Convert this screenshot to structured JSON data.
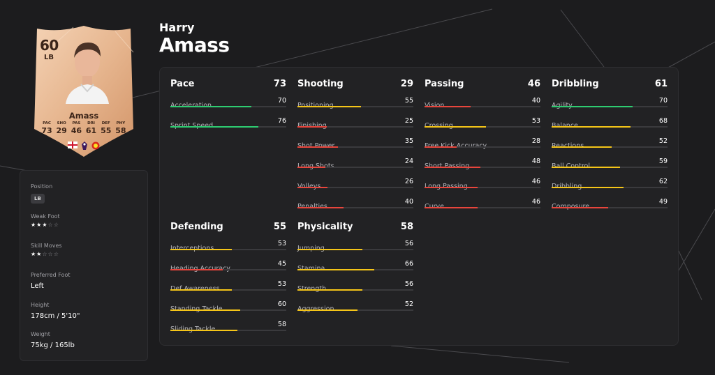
{
  "player": {
    "first_name": "Harry",
    "last_name": "Amass"
  },
  "card": {
    "rating": "60",
    "position": "LB",
    "name": "Amass",
    "stats": [
      {
        "label": "PAC",
        "value": "73"
      },
      {
        "label": "SHO",
        "value": "29"
      },
      {
        "label": "PAS",
        "value": "46"
      },
      {
        "label": "DRI",
        "value": "61"
      },
      {
        "label": "DEF",
        "value": "55"
      },
      {
        "label": "PHY",
        "value": "58"
      }
    ],
    "badges": [
      "england-flag-icon",
      "premier-league-icon",
      "manchester-united-crest-icon"
    ]
  },
  "info": {
    "position_label": "Position",
    "position_value": "LB",
    "weak_foot_label": "Weak Foot",
    "weak_foot_stars": 3,
    "skill_moves_label": "Skill Moves",
    "skill_moves_stars": 2,
    "preferred_foot_label": "Preferred Foot",
    "preferred_foot_value": "Left",
    "height_label": "Height",
    "height_value": "178cm / 5'10\"",
    "weight_label": "Weight",
    "weight_value": "75kg / 165lb"
  },
  "colors": {
    "bar_green": "#2ecc71",
    "bar_yellow": "#f5c518",
    "bar_red": "#e8453c",
    "card_light": "#f0c9a8",
    "card_dark": "#d99c72"
  },
  "groups": [
    {
      "key": "pace",
      "title": "Pace",
      "value": "73",
      "stats": [
        {
          "name": "Acceleration",
          "value": "70"
        },
        {
          "name": "Sprint Speed",
          "value": "76"
        }
      ]
    },
    {
      "key": "shooting",
      "title": "Shooting",
      "value": "29",
      "stats": [
        {
          "name": "Positioning",
          "value": "55"
        },
        {
          "name": "Finishing",
          "value": "25"
        },
        {
          "name": "Shot Power",
          "value": "35"
        },
        {
          "name": "Long Shots",
          "value": "24"
        },
        {
          "name": "Volleys",
          "value": "26"
        },
        {
          "name": "Penalties",
          "value": "40"
        }
      ]
    },
    {
      "key": "passing",
      "title": "Passing",
      "value": "46",
      "stats": [
        {
          "name": "Vision",
          "value": "40"
        },
        {
          "name": "Crossing",
          "value": "53"
        },
        {
          "name": "Free Kick Accuracy",
          "value": "28"
        },
        {
          "name": "Short Passing",
          "value": "48"
        },
        {
          "name": "Long Passing",
          "value": "46"
        },
        {
          "name": "Curve",
          "value": "46"
        }
      ]
    },
    {
      "key": "dribbling",
      "title": "Dribbling",
      "value": "61",
      "stats": [
        {
          "name": "Agility",
          "value": "70"
        },
        {
          "name": "Balance",
          "value": "68"
        },
        {
          "name": "Reactions",
          "value": "52"
        },
        {
          "name": "Ball Control",
          "value": "59"
        },
        {
          "name": "Dribbling",
          "value": "62"
        },
        {
          "name": "Composure",
          "value": "49"
        }
      ]
    },
    {
      "key": "defending",
      "title": "Defending",
      "value": "55",
      "stats": [
        {
          "name": "Interceptions",
          "value": "53"
        },
        {
          "name": "Heading Accuracy",
          "value": "45"
        },
        {
          "name": "Def Awareness",
          "value": "53"
        },
        {
          "name": "Standing Tackle",
          "value": "60"
        },
        {
          "name": "Sliding Tackle",
          "value": "58"
        }
      ]
    },
    {
      "key": "physicality",
      "title": "Physicality",
      "value": "58",
      "stats": [
        {
          "name": "Jumping",
          "value": "56"
        },
        {
          "name": "Stamina",
          "value": "66"
        },
        {
          "name": "Strength",
          "value": "56"
        },
        {
          "name": "Aggression",
          "value": "52"
        }
      ]
    }
  ]
}
